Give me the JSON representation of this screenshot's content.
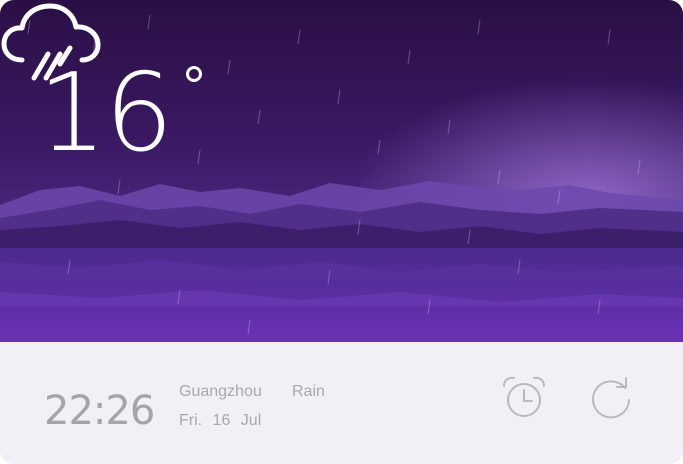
{
  "weather": {
    "temperature": "16",
    "condition_icon": "rain-cloud-icon",
    "city": "Guangzhou",
    "condition": "Rain",
    "date": "Fri. 16 Jul",
    "time": "22:26"
  },
  "actions": {
    "alarm_icon": "alarm-clock-icon",
    "refresh_icon": "refresh-icon"
  },
  "colors": {
    "sky_top": "#2a0f45",
    "sky_bottom": "#6a3ab3",
    "panel": "#f1f0f6",
    "muted_text": "#a8a8ac"
  }
}
